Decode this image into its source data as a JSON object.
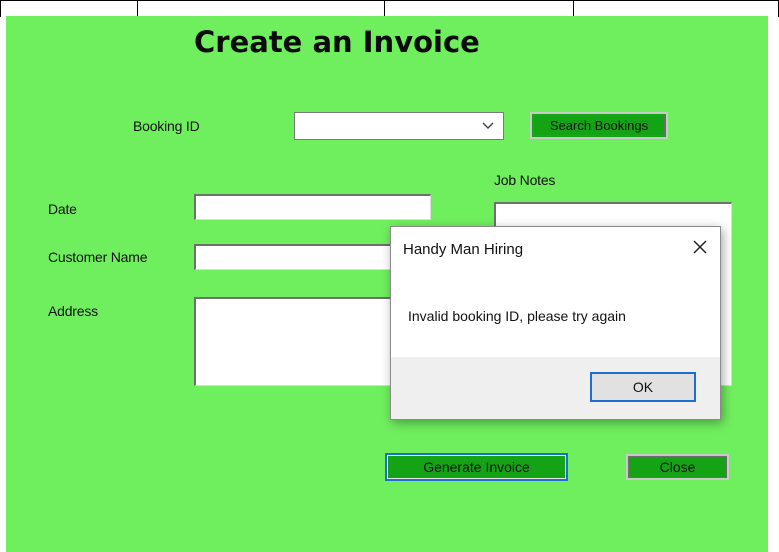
{
  "form": {
    "title": "Create an Invoice",
    "booking_id_label": "Booking ID",
    "booking_id_value": "",
    "search_button": "Search Bookings",
    "job_notes_label": "Job Notes",
    "date_label": "Date",
    "customer_name_label": "Customer Name",
    "address_label": "Address",
    "generate_button": "Generate Invoice",
    "close_button": "Close",
    "background_color": "#70ef5e",
    "button_color": "#14a314"
  },
  "dialog": {
    "title": "Handy Man Hiring",
    "message": "Invalid booking ID, please try again",
    "ok_button": "OK",
    "close_icon": "close-icon"
  }
}
